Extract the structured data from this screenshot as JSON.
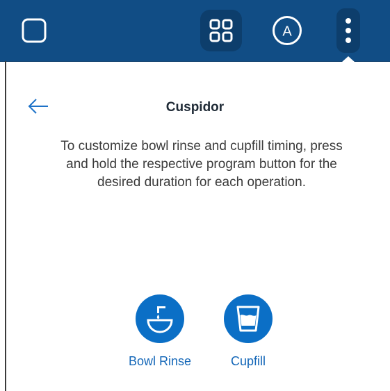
{
  "topbar": {
    "background": "#114d85",
    "icons": {
      "home": "rounded-square-icon",
      "apps": "grid-icon",
      "account": "account-a-icon",
      "more": "more-vertical-icon"
    },
    "account_initial": "A"
  },
  "page": {
    "title": "Cuspidor",
    "back_icon": "arrow-left-icon",
    "description": "To customize bowl rinse and cupfill timing, press and hold the respective program button for the desired duration for each operation."
  },
  "actions": [
    {
      "label": "Bowl Rinse",
      "icon": "bowl-rinse-icon"
    },
    {
      "label": "Cupfill",
      "icon": "cupfill-icon"
    }
  ],
  "colors": {
    "accent": "#0b6fc6",
    "link": "#1467b8",
    "title": "#1f2a36",
    "text": "#3b3b3b"
  }
}
